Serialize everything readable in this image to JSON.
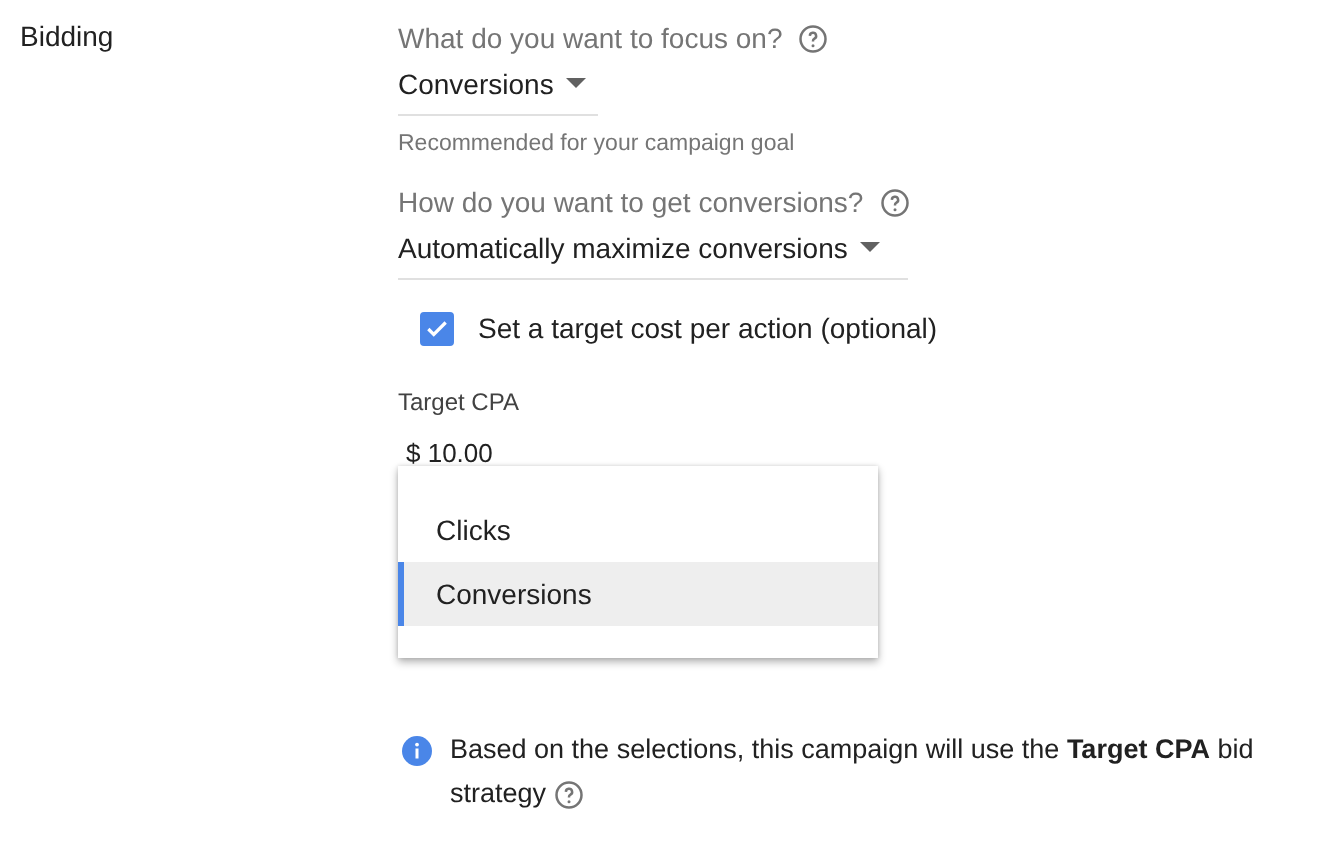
{
  "section_label": "Bidding",
  "focus": {
    "question": "What do you want to focus on?",
    "value": "Conversions",
    "hint": "Recommended for your campaign goal"
  },
  "method": {
    "question": "How do you want to get conversions?",
    "value": "Automatically maximize conversions"
  },
  "target_option": {
    "label": "Set a target cost per action (optional)",
    "checked": true
  },
  "target_cpa": {
    "label": "Target CPA",
    "value": "$ 10.00"
  },
  "focus_menu": {
    "items": [
      {
        "label": "Clicks",
        "selected": false
      },
      {
        "label": "Conversions",
        "selected": true
      }
    ]
  },
  "info": {
    "text": "Based on the selections, this campaign will use the **Target CPA** bid strategy"
  }
}
